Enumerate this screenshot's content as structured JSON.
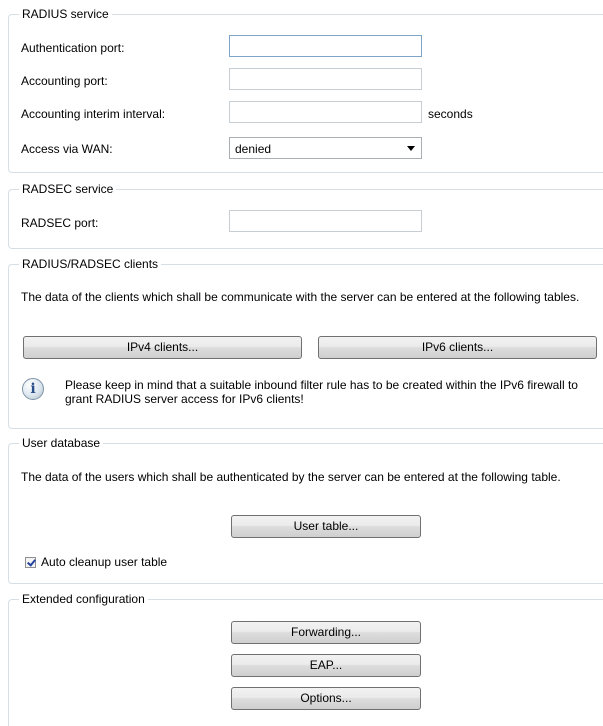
{
  "radius_service": {
    "title": "RADIUS service",
    "auth_port_label": "Authentication port:",
    "auth_port_value": "",
    "acct_port_label": "Accounting port:",
    "acct_port_value": "",
    "interim_label": "Accounting interim interval:",
    "interim_value": "",
    "interim_unit": "seconds",
    "wan_label": "Access via WAN:",
    "wan_value": "denied"
  },
  "radsec_service": {
    "title": "RADSEC service",
    "port_label": "RADSEC port:",
    "port_value": ""
  },
  "clients": {
    "title": "RADIUS/RADSEC clients",
    "description": "The data of the clients which shall be communicate with the server can be entered at the following tables.",
    "ipv4_button": "IPv4 clients...",
    "ipv6_button": "IPv6 clients...",
    "info_icon": "info-icon",
    "note": "Please keep in mind that a suitable inbound filter rule has to be created within the IPv6 firewall to grant RADIUS server access for IPv6 clients!"
  },
  "user_database": {
    "title": "User database",
    "description": "The data of the users which shall be authenticated by the server can be entered at the following table.",
    "user_table_button": "User table...",
    "auto_cleanup_label": "Auto cleanup user table",
    "auto_cleanup_checked": true
  },
  "extended": {
    "title": "Extended configuration",
    "forwarding_button": "Forwarding...",
    "eap_button": "EAP...",
    "options_button": "Options..."
  }
}
